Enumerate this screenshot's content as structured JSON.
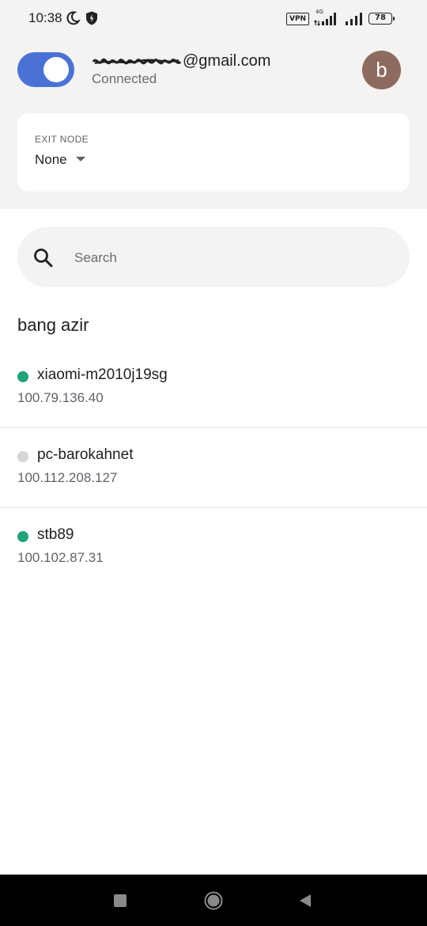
{
  "status_bar": {
    "time": "10:38",
    "vpn_badge": "VPN",
    "network_type": "4G",
    "battery_level": "78",
    "icons": [
      "moon-icon",
      "shield-icon",
      "signal-icon",
      "battery-icon"
    ]
  },
  "account": {
    "email_domain": "@gmail.com",
    "status": "Connected",
    "avatar_initial": "b",
    "toggle_on": true
  },
  "exit_node": {
    "label": "EXIT NODE",
    "value": "None"
  },
  "search": {
    "placeholder": "Search"
  },
  "section": {
    "title": "bang azir"
  },
  "devices": [
    {
      "name": "xiaomi-m2010j19sg",
      "ip": "100.79.136.40",
      "online": true
    },
    {
      "name": "pc-barokahnet",
      "ip": "100.112.208.127",
      "online": false
    },
    {
      "name": "stb89",
      "ip": "100.102.87.31",
      "online": true
    }
  ],
  "colors": {
    "accent": "#4a72d6",
    "online": "#1fa37a",
    "offline": "#d6d6d6",
    "avatar": "#8d6b5e",
    "top_background": "#f4f3f1"
  },
  "nav_bar": {
    "icons": [
      "recents-icon",
      "home-icon",
      "back-icon"
    ]
  }
}
